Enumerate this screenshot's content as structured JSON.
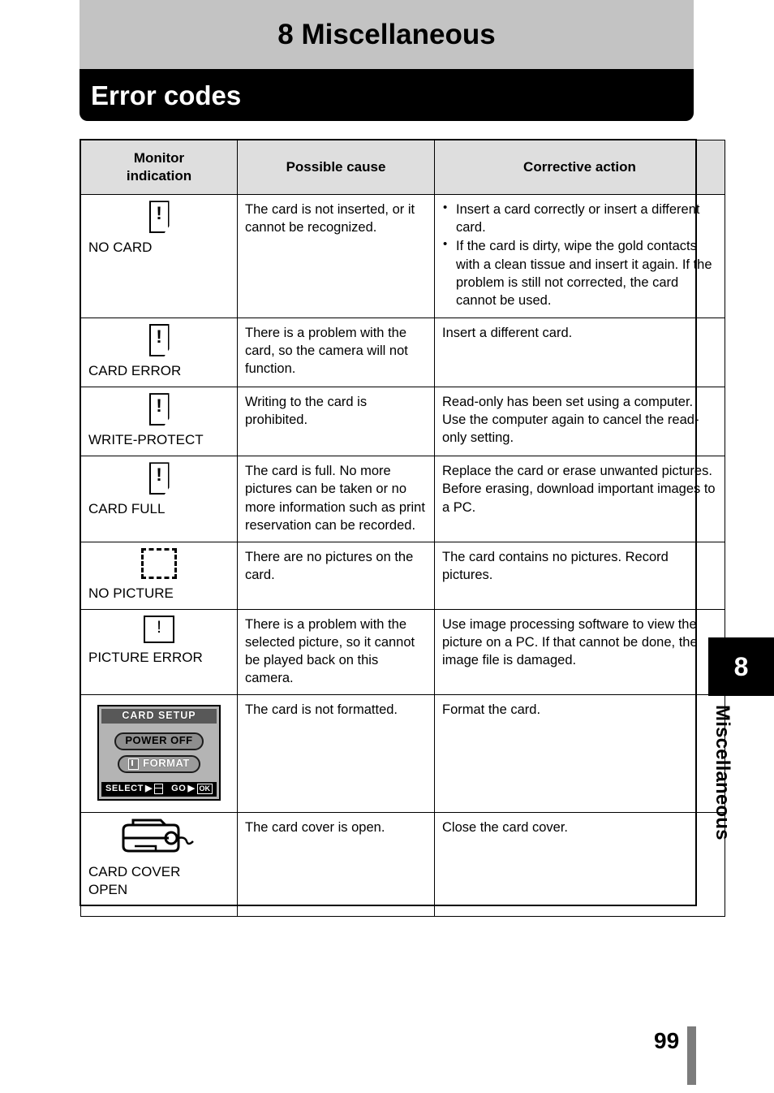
{
  "header": {
    "chapter_title": "8 Miscellaneous",
    "section_title": "Error codes"
  },
  "table": {
    "headers": [
      "Monitor\nindication",
      "Possible cause",
      "Corrective action"
    ],
    "rows": [
      {
        "monitor_icon": "memory-card-warning-icon",
        "monitor_label": "NO CARD",
        "cause": "The card is not inserted, or it cannot be recognized.",
        "action_bullets": [
          "Insert a card correctly or insert a different card.",
          "If the card is dirty, wipe the gold contacts with a clean tissue and insert it again. If the problem is still not corrected, the card cannot be used."
        ]
      },
      {
        "monitor_icon": "memory-card-warning-icon",
        "monitor_label": "CARD ERROR",
        "cause": "There is a problem with the card, so the camera will not function.",
        "action": "Insert a different card."
      },
      {
        "monitor_icon": "memory-card-warning-icon",
        "monitor_label": "WRITE-PROTECT",
        "cause": "Writing to the card is prohibited.",
        "action": "Read-only has been set using a computer. Use the computer again to cancel the read-only setting."
      },
      {
        "monitor_icon": "memory-card-warning-icon",
        "monitor_label": "CARD FULL",
        "cause": "The card is full. No more pictures can be taken or no more information such as print reservation can be recorded.",
        "action": "Replace the card or erase unwanted pictures. Before erasing, download important images to a PC."
      },
      {
        "monitor_icon": "dashed-rectangle-icon",
        "monitor_label": "NO PICTURE",
        "cause": "There are no pictures on the card.",
        "action": "The card contains no pictures. Record pictures."
      },
      {
        "monitor_icon": "square-warning-icon",
        "monitor_label": "PICTURE ERROR",
        "cause": "There is a problem with the selected picture, so it cannot be played back on this camera.",
        "action": "Use image processing software to view the picture on a PC. If that cannot be done, the image file is damaged."
      },
      {
        "monitor_icon": "card-setup-lcd-screen",
        "monitor_label": "",
        "cause": "The card is not formatted.",
        "action": "Format the card."
      },
      {
        "monitor_icon": "camera-card-cover-open-icon",
        "monitor_label": "CARD COVER\nOPEN",
        "cause": "The card cover is open.",
        "action": "Close the card cover."
      }
    ]
  },
  "lcd_screen": {
    "title": "CARD SETUP",
    "power_off_label": "POWER OFF",
    "format_label": "FORMAT",
    "format_icon": "trash-can-icon",
    "footer_select_label": "SELECT",
    "footer_select_arrow": "▶",
    "footer_select_icon": "arrow-pad-icon",
    "footer_go_label": "GO",
    "footer_go_arrow": "▶",
    "footer_go_icon": "OK"
  },
  "thumb_tab": {
    "number": "8",
    "label": "Miscellaneous"
  },
  "footer": {
    "page_number": "99"
  },
  "colors": {
    "chapter_bar": "#c3c3c3",
    "section_bar": "#000000",
    "table_header": "#dedede",
    "lcd_background": "#b4b4b4",
    "lcd_title_bar": "#585858",
    "page_rule": "#7c7c7c"
  }
}
